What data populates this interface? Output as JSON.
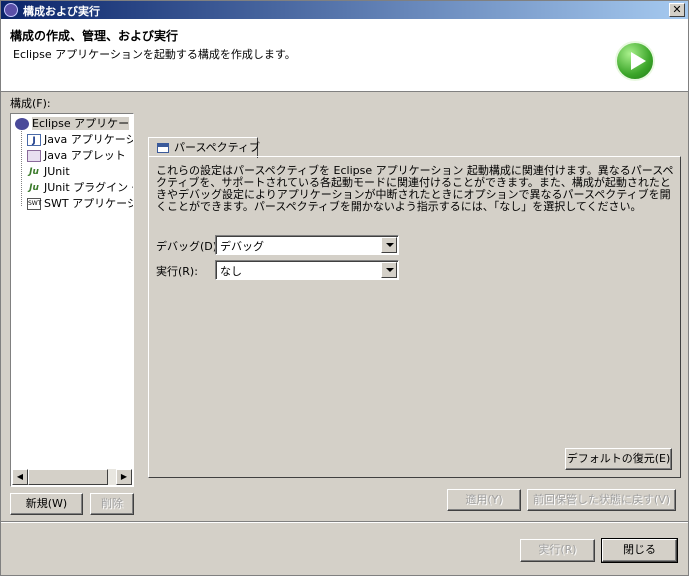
{
  "window": {
    "title": "構成および実行",
    "close_label": "✕"
  },
  "header": {
    "title": "構成の作成、管理、および実行",
    "subtitle": "Eclipse アプリケーションを起動する構成を作成します。"
  },
  "configs": {
    "label": "構成(F):",
    "items": [
      {
        "label": "Eclipse アプリケー",
        "icon": "eclipse-icon"
      },
      {
        "label": "Java アプリケーシ",
        "icon": "java-app-icon"
      },
      {
        "label": "Java アプレット",
        "icon": "java-applet-icon"
      },
      {
        "label": "JUnit",
        "icon": "junit-icon"
      },
      {
        "label": "JUnit プラグイン・",
        "icon": "junit-plugin-icon"
      },
      {
        "label": "SWT アプリケーシ",
        "icon": "swt-icon"
      }
    ],
    "icon_glyphs": {
      "java": "J",
      "junit": "Ju",
      "swt": "SWT"
    },
    "new_button": "新規(W)",
    "delete_button": "削除"
  },
  "tab": {
    "label": "パースペクティブ"
  },
  "description": "これらの設定はパースペクティブを Eclipse アプリケーション 起動構成に関連付けます。異なるパースペクティブを、サポートされている各起動モードに関連付けることができます。また、構成が起動されたときやデバッグ設定によりアプリケーションが中断されたときにオプションで異なるパースペクティブを開くことができます。パースペクティブを開かないよう指示するには、「なし」を選択してください。",
  "fields": {
    "debug": {
      "label": "デバッグ(D):",
      "value": "デバッグ"
    },
    "run": {
      "label": "実行(R):",
      "value": "なし"
    }
  },
  "buttons": {
    "restore_defaults": "デフォルトの復元(E)",
    "apply": "適用(Y)",
    "revert": "前回保管した状態に戻す(V)",
    "run": "実行(R)",
    "close": "閉じる"
  }
}
